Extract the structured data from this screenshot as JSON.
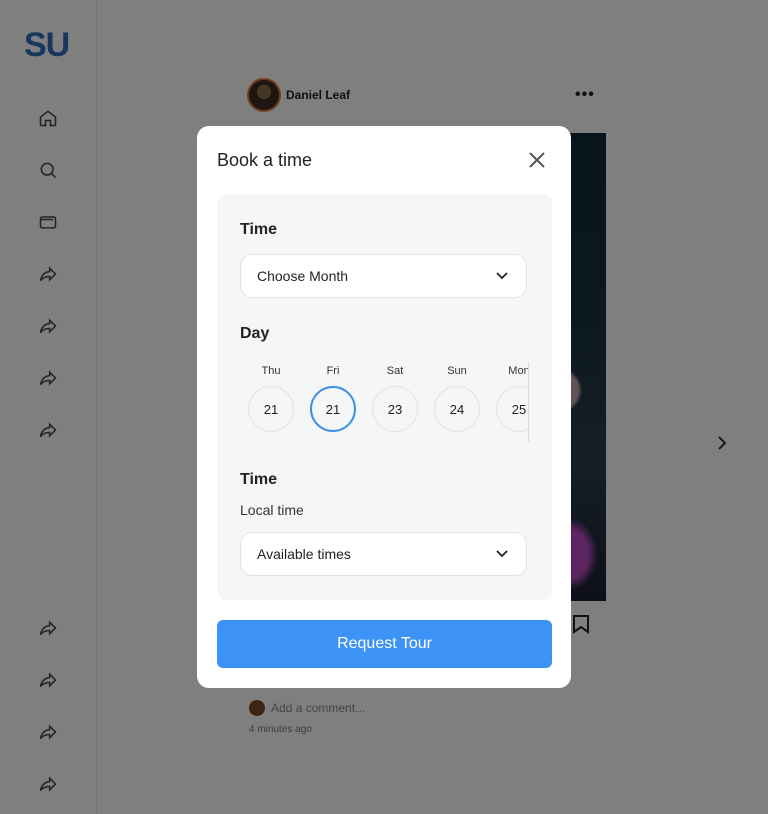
{
  "app": {
    "logo": "SU"
  },
  "sidebar": {
    "icons": [
      "home-icon",
      "search-icon",
      "wallet-icon",
      "share-icon",
      "share-icon",
      "share-icon",
      "share-icon",
      "share-icon",
      "share-icon",
      "share-icon",
      "share-icon"
    ]
  },
  "post": {
    "username": "Daniel Leaf",
    "more": "•••",
    "comment_placeholder": "Add a comment...",
    "time": "4 minutes ago"
  },
  "modal": {
    "title": "Book a time",
    "time_label": "Time",
    "month_select": "Choose Month",
    "day_label": "Day",
    "days": [
      {
        "name": "Thu",
        "date": "21",
        "selected": false
      },
      {
        "name": "Fri",
        "date": "21",
        "selected": true
      },
      {
        "name": "Sat",
        "date": "23",
        "selected": false
      },
      {
        "name": "Sun",
        "date": "24",
        "selected": false
      },
      {
        "name": "Mon",
        "date": "25",
        "selected": false
      }
    ],
    "time_label_2": "Time",
    "local_time": "Local time",
    "times_select": "Available times",
    "submit": "Request Tour"
  },
  "colors": {
    "accent": "#3d93f5",
    "selected_ring": "#3f8fe6",
    "logo": "#2f6fbf"
  }
}
